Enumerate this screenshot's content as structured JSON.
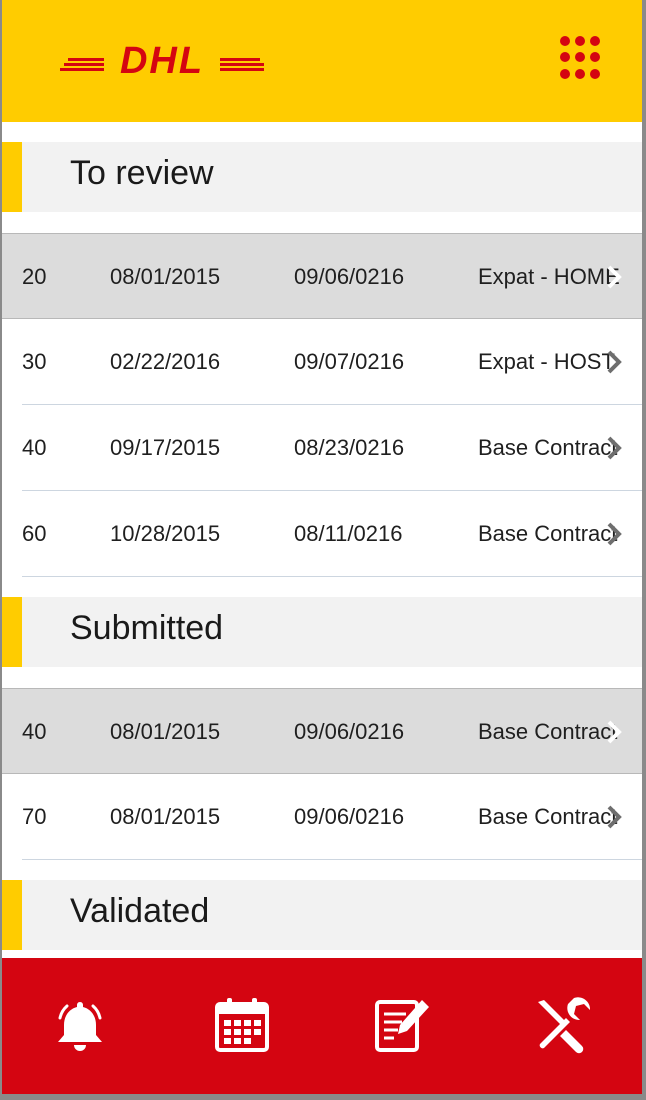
{
  "header": {
    "logo_text": "DHL",
    "apps_icon": "grid-dots-icon",
    "brand_yellow": "#ffcc00",
    "brand_red": "#d40511"
  },
  "sections": [
    {
      "title": "To review",
      "rows": [
        {
          "num": "20",
          "date1": "08/01/2015",
          "date2": "09/06/0216",
          "type": "Expat - HOME",
          "highlighted": true
        },
        {
          "num": "30",
          "date1": "02/22/2016",
          "date2": "09/07/0216",
          "type": "Expat - HOST",
          "highlighted": false
        },
        {
          "num": "40",
          "date1": "09/17/2015",
          "date2": "08/23/0216",
          "type": "Base Contract",
          "highlighted": false
        },
        {
          "num": "60",
          "date1": "10/28/2015",
          "date2": "08/11/0216",
          "type": "Base Contract",
          "highlighted": false
        }
      ]
    },
    {
      "title": "Submitted",
      "rows": [
        {
          "num": "40",
          "date1": "08/01/2015",
          "date2": "09/06/0216",
          "type": "Base Contract",
          "highlighted": true
        },
        {
          "num": "70",
          "date1": "08/01/2015",
          "date2": "09/06/0216",
          "type": "Base Contract",
          "highlighted": false
        }
      ]
    },
    {
      "title": "Validated",
      "rows": []
    }
  ],
  "footer": {
    "icons": [
      "bell-icon",
      "calendar-icon",
      "edit-document-icon",
      "tools-icon"
    ]
  }
}
